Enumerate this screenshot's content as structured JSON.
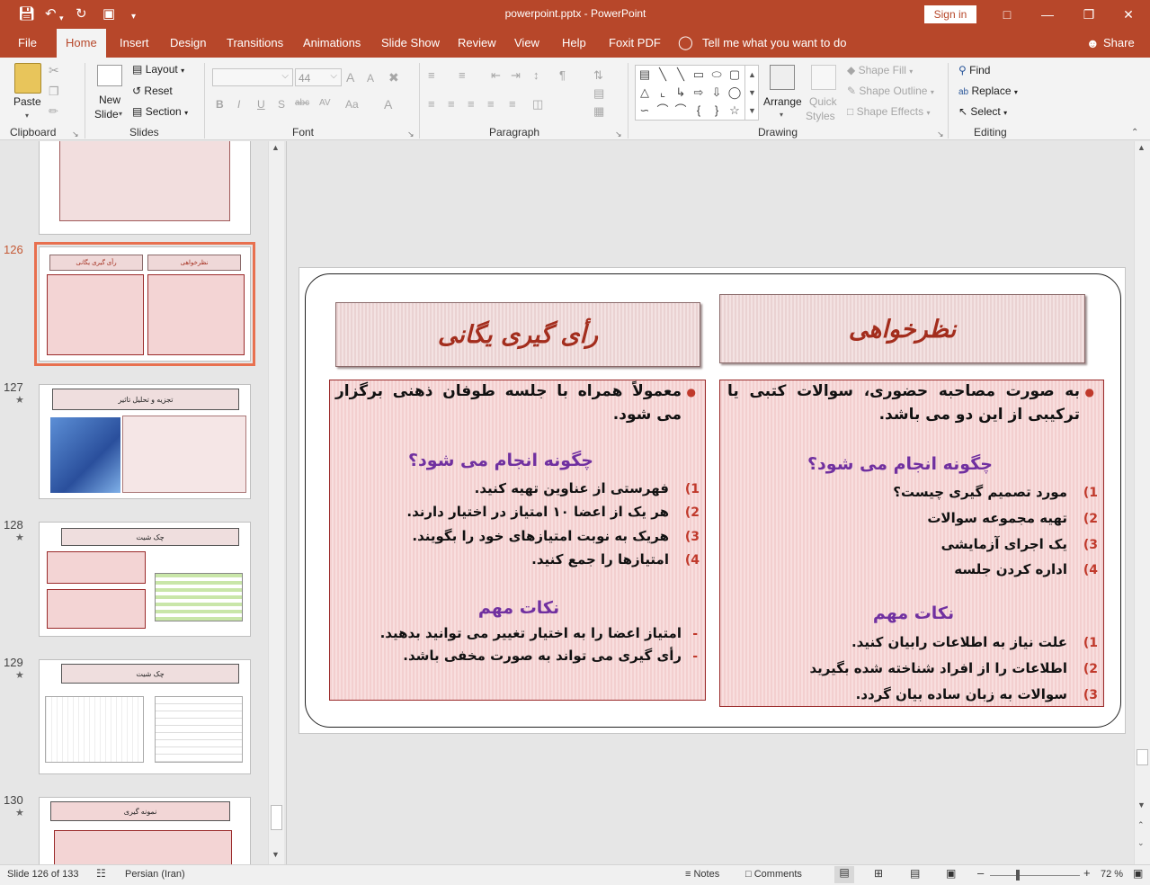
{
  "window": {
    "title": "powerpoint.pptx  -  PowerPoint",
    "sign_in": "Sign in"
  },
  "qat": {
    "save_icon": "save-icon",
    "undo_icon": "undo-icon",
    "redo_icon": "redo-icon",
    "present_icon": "present-icon",
    "customize_icon": "chevron-down-icon"
  },
  "tabs": [
    "File",
    "Home",
    "Insert",
    "Design",
    "Transitions",
    "Animations",
    "Slide Show",
    "Review",
    "View",
    "Help",
    "Foxit PDF"
  ],
  "tell_me": "Tell me what you want to do",
  "share": "Share",
  "ribbon": {
    "clipboard": {
      "paste": "Paste",
      "label": "Clipboard"
    },
    "slides": {
      "new_slide": "New",
      "new_slide2": "Slide",
      "layout": "Layout",
      "reset": "Reset",
      "section": "Section",
      "label": "Slides"
    },
    "font": {
      "size": "44",
      "label": "Font",
      "bold": "B",
      "italic": "I",
      "underline": "U",
      "shadow": "S",
      "strike": "abc",
      "spacing": "AV",
      "case": "Aa",
      "color": "A",
      "grow": "A",
      "shrink": "A"
    },
    "paragraph": {
      "label": "Paragraph"
    },
    "drawing": {
      "arrange": "Arrange",
      "quick_styles": "Quick",
      "quick_styles2": "Styles",
      "shape_fill": "Shape Fill",
      "shape_outline": "Shape Outline",
      "shape_effects": "Shape Effects",
      "label": "Drawing"
    },
    "editing": {
      "find": "Find",
      "replace": "Replace",
      "select": "Select",
      "label": "Editing"
    }
  },
  "thumbnails": [
    {
      "num": "",
      "star": ""
    },
    {
      "num": "126",
      "star": ""
    },
    {
      "num": "127",
      "star": "★"
    },
    {
      "num": "128",
      "star": "★"
    },
    {
      "num": "129",
      "star": "★"
    },
    {
      "num": "130",
      "star": "★"
    }
  ],
  "thumb_text": {
    "t126_left": "رأی گیری یگانی",
    "t126_right": "نظرخواهی",
    "t127_title": "تجزیه و تحلیل تاثیر",
    "t128_title": "چک شیت",
    "t129_title": "چک شیت",
    "t130_title": "نمونه گیری"
  },
  "slide": {
    "left_title": "رأی گیری یگانی",
    "right_title": "نظرخواهی",
    "left": {
      "bullet": "معمولاً همراه با جلسه طوفان ذهنی برگزار می شود.",
      "how": "چگونه انجام می شود؟",
      "steps": [
        "فهرستی از عناوین تهیه کنید.",
        "هر یک از اعضا ۱۰ امتیاز در اختیار دارند.",
        "هریک به نوبت امتیازهای خود را بگویند.",
        "امتیازها را جمع کنید."
      ],
      "step_nums": [
        "1)",
        "2)",
        "3)",
        "4)"
      ],
      "notes_head": "نکات مهم",
      "notes": [
        "امتیاز اعضا را به اختیار تغییر می توانید بدهید.",
        "رأی گیری می تواند به صورت مخفی باشد."
      ],
      "note_marks": [
        "-",
        "-"
      ]
    },
    "right": {
      "bullet": "به صورت مصاحبه حضوری، سوالات کتبی یا ترکیبی از این دو می باشد.",
      "how": "چگونه انجام می شود؟",
      "steps": [
        "مورد تصمیم گیری چیست؟",
        "تهیه مجموعه سوالات",
        "یک اجرای آزمایشی",
        "اداره کردن جلسه"
      ],
      "step_nums": [
        "1)",
        "2)",
        "3)",
        "4)"
      ],
      "notes_head": "نکات مهم",
      "notes": [
        "علت نیاز به اطلاعات رابیان کنید.",
        "اطلاعات را از افراد شناخته شده بگیرید",
        "سوالات به زبان ساده بیان گردد."
      ],
      "note_nums": [
        "1)",
        "2)",
        "3)"
      ]
    }
  },
  "status": {
    "slide_info": "Slide 126 of 133",
    "language": "Persian (Iran)",
    "notes": "Notes",
    "comments": "Comments",
    "zoom": "72 %"
  }
}
